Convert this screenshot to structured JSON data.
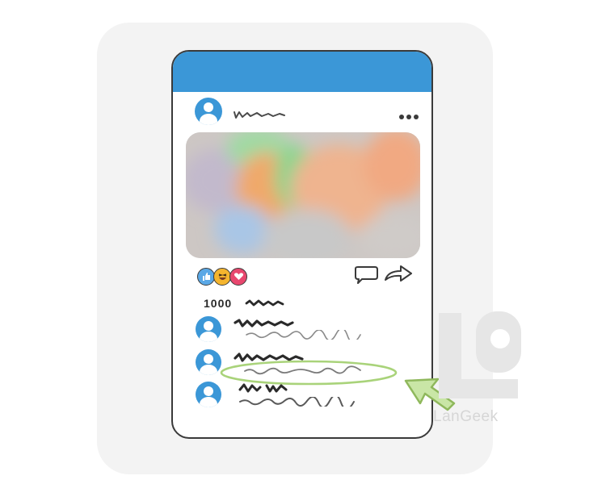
{
  "post": {
    "likes_count": "1000"
  },
  "reactions": [
    "like",
    "haha",
    "love"
  ],
  "watermark": {
    "brand": "LanGeek"
  },
  "colors": {
    "header": "#3b97d7",
    "avatar": "#3b97d7",
    "like": "#5aa8e6",
    "haha": "#f5b52e",
    "love": "#e8476e",
    "highlight": "#a9d37a"
  },
  "icons": {
    "more": "more-horizontal-icon",
    "comment": "comment-icon",
    "share": "share-icon"
  }
}
